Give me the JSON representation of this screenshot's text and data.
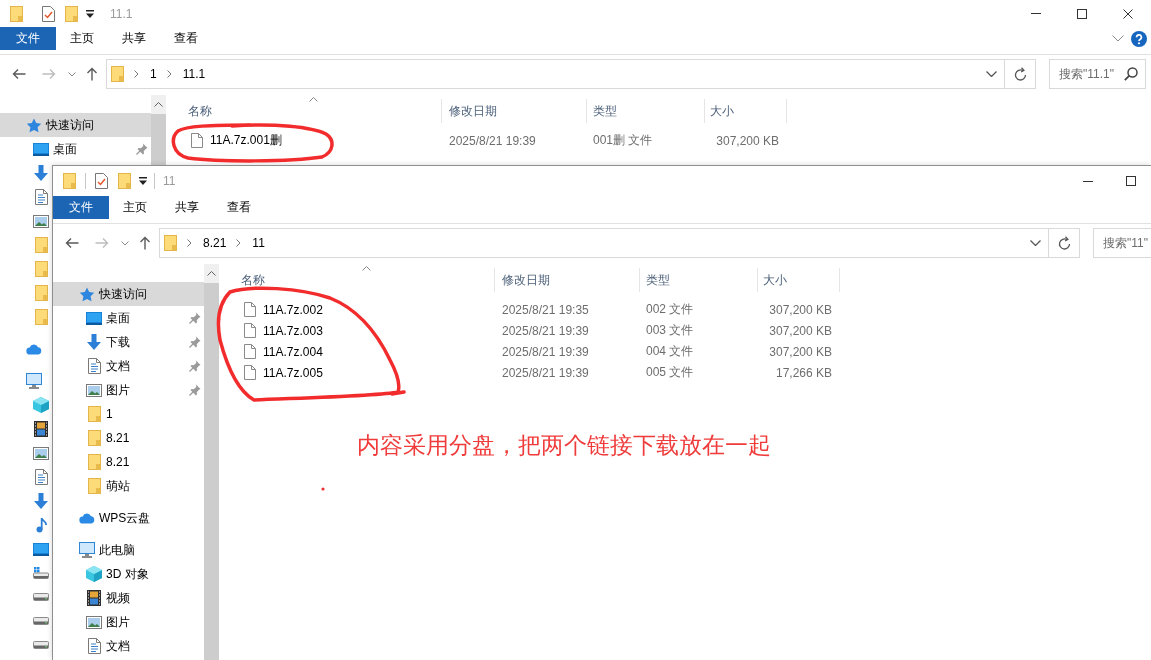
{
  "windows": [
    {
      "title": "11.1",
      "ribbon_tabs": [
        {
          "label": "文件",
          "kind": "menu"
        },
        {
          "label": "主页",
          "kind": "tab"
        },
        {
          "label": "共享",
          "kind": "tab"
        },
        {
          "label": "查看",
          "kind": "tab"
        }
      ],
      "path": [
        "1",
        "11.1"
      ],
      "search": {
        "placeholder": "搜索\"11.1\""
      },
      "sidebar": [
        {
          "kind": "quick-access",
          "label": "快速访问",
          "selected": true,
          "children": [
            {
              "kind": "desktop",
              "label": "桌面",
              "selected": false,
              "pinned": true
            },
            {
              "kind": "downloads",
              "selected": false
            },
            {
              "kind": "documents",
              "selected": false
            },
            {
              "kind": "pictures",
              "selected": false
            },
            {
              "kind": "folder",
              "selected": false
            },
            {
              "kind": "folder",
              "selected": false
            },
            {
              "kind": "folder",
              "selected": false
            },
            {
              "kind": "folder",
              "selected": false
            }
          ]
        },
        {
          "kind": "cloud",
          "selected": false
        },
        {
          "kind": "pc",
          "selected": false,
          "children": [
            {
              "kind": "objects3d",
              "selected": false
            },
            {
              "kind": "videos",
              "selected": false
            },
            {
              "kind": "pictures",
              "selected": false
            },
            {
              "kind": "documents",
              "selected": false
            },
            {
              "kind": "downloads",
              "selected": false
            },
            {
              "kind": "music",
              "selected": false
            },
            {
              "kind": "desktop",
              "selected": false
            },
            {
              "kind": "system-drive",
              "selected": false
            },
            {
              "kind": "drive",
              "selected": false
            },
            {
              "kind": "drive",
              "selected": false
            },
            {
              "kind": "drive",
              "selected": false
            }
          ]
        }
      ],
      "columns": [
        {
          "label": "名称",
          "sorted": true
        },
        {
          "label": "修改日期",
          "sorted": false
        },
        {
          "label": "类型",
          "sorted": false
        },
        {
          "label": "大小",
          "sorted": false
        }
      ],
      "files": [
        {
          "name": "11A.7z.001删",
          "modified": "2025/8/21 19:39",
          "type": "001删 文件",
          "size": "307,200 KB"
        }
      ]
    },
    {
      "title": "11",
      "ribbon_tabs": [
        {
          "label": "文件",
          "kind": "menu"
        },
        {
          "label": "主页",
          "kind": "tab"
        },
        {
          "label": "共享",
          "kind": "tab"
        },
        {
          "label": "查看",
          "kind": "tab"
        }
      ],
      "path": [
        "8.21",
        "11"
      ],
      "search": {
        "placeholder": "搜索\"11\""
      },
      "sidebar": [
        {
          "kind": "quick-access",
          "label": "快速访问",
          "selected": true,
          "children": [
            {
              "kind": "desktop",
              "label": "桌面",
              "selected": false,
              "pinned": true
            },
            {
              "kind": "downloads",
              "label": "下载",
              "selected": false,
              "pinned": true
            },
            {
              "kind": "documents",
              "label": "文档",
              "selected": false,
              "pinned": true
            },
            {
              "kind": "pictures",
              "label": "图片",
              "selected": false,
              "pinned": true
            },
            {
              "kind": "folder",
              "label": "1",
              "selected": false,
              "pinned": false
            },
            {
              "kind": "folder",
              "label": "8.21",
              "selected": false,
              "pinned": false
            },
            {
              "kind": "folder",
              "label": "8.21",
              "selected": false,
              "pinned": false
            },
            {
              "kind": "folder",
              "label": "萌站",
              "selected": false,
              "pinned": false
            }
          ]
        },
        {
          "kind": "cloud",
          "label": "WPS云盘",
          "selected": false
        },
        {
          "kind": "pc",
          "label": "此电脑",
          "selected": false,
          "children": [
            {
              "kind": "objects3d",
              "label": "3D 对象",
              "selected": false
            },
            {
              "kind": "videos",
              "label": "视频",
              "selected": false
            },
            {
              "kind": "pictures",
              "label": "图片",
              "selected": false
            },
            {
              "kind": "documents",
              "label": "文档",
              "selected": false
            }
          ]
        }
      ],
      "columns": [
        {
          "label": "名称",
          "sorted": true
        },
        {
          "label": "修改日期",
          "sorted": false
        },
        {
          "label": "类型",
          "sorted": false
        },
        {
          "label": "大小",
          "sorted": false
        }
      ],
      "files": [
        {
          "name": "11A.7z.002",
          "modified": "2025/8/21 19:35",
          "type": "002 文件",
          "size": "307,200 KB"
        },
        {
          "name": "11A.7z.003",
          "modified": "2025/8/21 19:39",
          "type": "003 文件",
          "size": "307,200 KB"
        },
        {
          "name": "11A.7z.004",
          "modified": "2025/8/21 19:39",
          "type": "004 文件",
          "size": "307,200 KB"
        },
        {
          "name": "11A.7z.005",
          "modified": "2025/8/21 19:39",
          "type": "005 文件",
          "size": "17,266 KB"
        }
      ]
    }
  ],
  "annotation": {
    "note": "内容采用分盘，把两个链接下载放在一起"
  }
}
